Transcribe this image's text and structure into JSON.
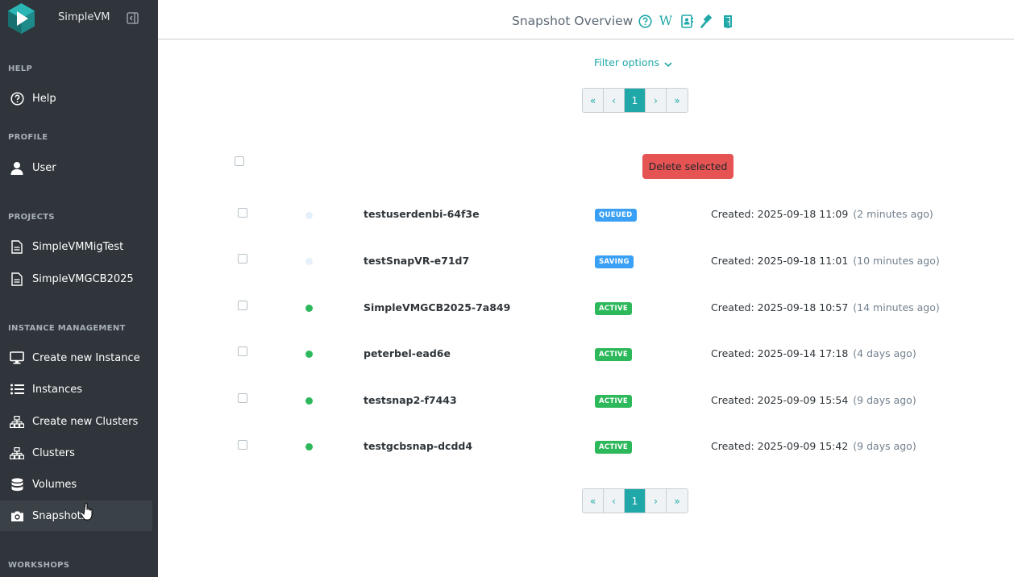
{
  "app": {
    "name": "SimpleVM"
  },
  "header": {
    "title": "Snapshot Overview"
  },
  "sidebar": {
    "sections": [
      {
        "title": "HELP",
        "items": [
          {
            "label": "Help",
            "icon": "question-circle-icon"
          }
        ]
      },
      {
        "title": "PROFILE",
        "items": [
          {
            "label": "User",
            "icon": "user-icon"
          }
        ]
      },
      {
        "title": "PROJECTS",
        "items": [
          {
            "label": "SimpleVMMigTest",
            "icon": "document-icon"
          },
          {
            "label": "SimpleVMGCB2025",
            "icon": "document-icon"
          }
        ]
      },
      {
        "title": "INSTANCE MANAGEMENT",
        "items": [
          {
            "label": "Create new Instance",
            "icon": "monitor-icon"
          },
          {
            "label": "Instances",
            "icon": "list-icon"
          },
          {
            "label": "Create new Clusters",
            "icon": "sitemap-icon"
          },
          {
            "label": "Clusters",
            "icon": "sitemap-icon"
          },
          {
            "label": "Volumes",
            "icon": "database-icon"
          },
          {
            "label": "Snapshots",
            "icon": "camera-icon",
            "active": true
          }
        ]
      },
      {
        "title": "WORKSHOPS",
        "items": []
      }
    ]
  },
  "filter": {
    "label": "Filter options"
  },
  "pagination": {
    "first": "«",
    "prev": "‹",
    "current": "1",
    "next": "›",
    "last": "»"
  },
  "actions": {
    "delete_selected": "Delete selected"
  },
  "colors": {
    "accent": "#20a8a8",
    "danger": "#e55353",
    "success": "#2eb85c",
    "info": "#39a0f5",
    "pending_dot": "#e6f0fa"
  },
  "snapshots": [
    {
      "name": "testuserdenbi-64f3e",
      "status": "QUEUED",
      "created": "Created: 2025-09-18 11:09",
      "ago": "(2 minutes ago)"
    },
    {
      "name": "testSnapVR-e71d7",
      "status": "SAVING",
      "created": "Created: 2025-09-18 11:01",
      "ago": "(10 minutes ago)"
    },
    {
      "name": "SimpleVMGCB2025-7a849",
      "status": "ACTIVE",
      "created": "Created: 2025-09-18 10:57",
      "ago": "(14 minutes ago)"
    },
    {
      "name": "peterbel-ead6e",
      "status": "ACTIVE",
      "created": "Created: 2025-09-14 17:18",
      "ago": "(4 days ago)"
    },
    {
      "name": "testsnap2-f7443",
      "status": "ACTIVE",
      "created": "Created: 2025-09-09 15:54",
      "ago": "(9 days ago)"
    },
    {
      "name": "testgcbsnap-dcdd4",
      "status": "ACTIVE",
      "created": "Created: 2025-09-09 15:42",
      "ago": "(9 days ago)"
    }
  ]
}
